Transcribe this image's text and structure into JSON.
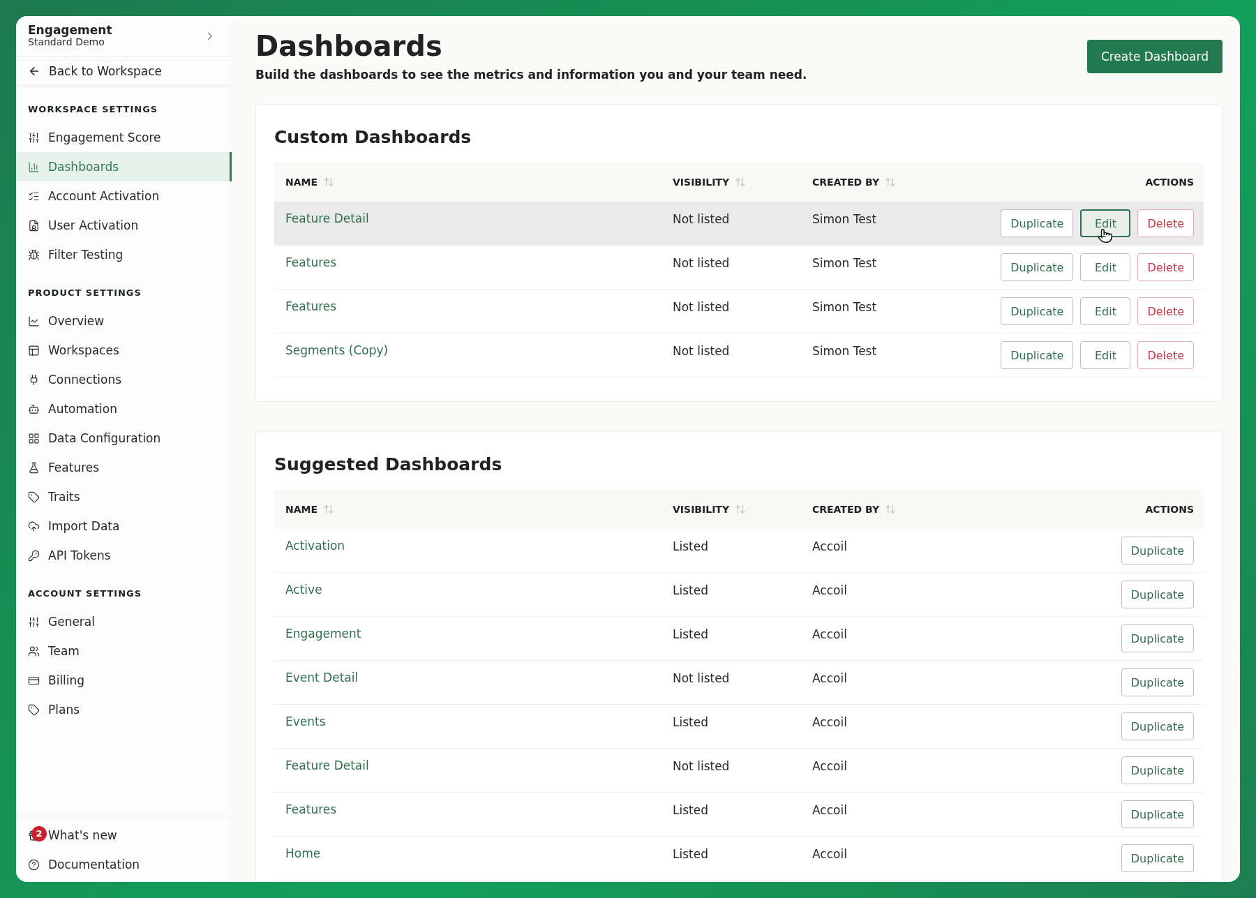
{
  "workspace": {
    "name": "Engagement",
    "subtitle": "Standard Demo"
  },
  "back_link": "Back to Workspace",
  "sidebar": {
    "sections": [
      {
        "title": "WORKSPACE SETTINGS",
        "items": [
          {
            "label": "Engagement Score",
            "selected": false
          },
          {
            "label": "Dashboards",
            "selected": true
          },
          {
            "label": "Account Activation",
            "selected": false
          },
          {
            "label": "User Activation",
            "selected": false
          },
          {
            "label": "Filter Testing",
            "selected": false
          }
        ]
      },
      {
        "title": "PRODUCT SETTINGS",
        "items": [
          {
            "label": "Overview",
            "selected": false
          },
          {
            "label": "Workspaces",
            "selected": false
          },
          {
            "label": "Connections",
            "selected": false
          },
          {
            "label": "Automation",
            "selected": false
          },
          {
            "label": "Data Configuration",
            "selected": false
          },
          {
            "label": "Features",
            "selected": false
          },
          {
            "label": "Traits",
            "selected": false
          },
          {
            "label": "Import Data",
            "selected": false
          },
          {
            "label": "API Tokens",
            "selected": false
          }
        ]
      },
      {
        "title": "ACCOUNT SETTINGS",
        "items": [
          {
            "label": "General",
            "selected": false
          },
          {
            "label": "Team",
            "selected": false
          },
          {
            "label": "Billing",
            "selected": false
          },
          {
            "label": "Plans",
            "selected": false
          }
        ]
      }
    ],
    "footer": [
      {
        "label": "What's new",
        "badge": "2"
      },
      {
        "label": "Documentation"
      }
    ]
  },
  "page": {
    "title": "Dashboards",
    "subtitle": "Build the dashboards to see the metrics and information you and your team need.",
    "primary_button": "Create Dashboard"
  },
  "cards": [
    {
      "title": "Custom Dashboards",
      "columns": [
        "NAME",
        "VISIBILITY",
        "CREATED BY",
        "ACTIONS"
      ],
      "rows": [
        {
          "name": "Feature Detail",
          "visibility": "Not listed",
          "created_by": "Simon Test",
          "actions": [
            "Duplicate",
            "Edit",
            "Delete"
          ],
          "hovered": true
        },
        {
          "name": "Features",
          "visibility": "Not listed",
          "created_by": "Simon Test",
          "actions": [
            "Duplicate",
            "Edit",
            "Delete"
          ],
          "hovered": false
        },
        {
          "name": "Features",
          "visibility": "Not listed",
          "created_by": "Simon Test",
          "actions": [
            "Duplicate",
            "Edit",
            "Delete"
          ],
          "hovered": false
        },
        {
          "name": "Segments (Copy)",
          "visibility": "Not listed",
          "created_by": "Simon Test",
          "actions": [
            "Duplicate",
            "Edit",
            "Delete"
          ],
          "hovered": false
        }
      ]
    },
    {
      "title": "Suggested Dashboards",
      "columns": [
        "NAME",
        "VISIBILITY",
        "CREATED BY",
        "ACTIONS"
      ],
      "rows": [
        {
          "name": "Activation",
          "visibility": "Listed",
          "created_by": "Accoil",
          "actions": [
            "Duplicate"
          ],
          "hovered": false
        },
        {
          "name": "Active",
          "visibility": "Listed",
          "created_by": "Accoil",
          "actions": [
            "Duplicate"
          ],
          "hovered": false
        },
        {
          "name": "Engagement",
          "visibility": "Listed",
          "created_by": "Accoil",
          "actions": [
            "Duplicate"
          ],
          "hovered": false
        },
        {
          "name": "Event Detail",
          "visibility": "Not listed",
          "created_by": "Accoil",
          "actions": [
            "Duplicate"
          ],
          "hovered": false
        },
        {
          "name": "Events",
          "visibility": "Listed",
          "created_by": "Accoil",
          "actions": [
            "Duplicate"
          ],
          "hovered": false
        },
        {
          "name": "Feature Detail",
          "visibility": "Not listed",
          "created_by": "Accoil",
          "actions": [
            "Duplicate"
          ],
          "hovered": false
        },
        {
          "name": "Features",
          "visibility": "Listed",
          "created_by": "Accoil",
          "actions": [
            "Duplicate"
          ],
          "hovered": false
        },
        {
          "name": "Home",
          "visibility": "Listed",
          "created_by": "Accoil",
          "actions": [
            "Duplicate"
          ],
          "hovered": false
        }
      ]
    }
  ]
}
